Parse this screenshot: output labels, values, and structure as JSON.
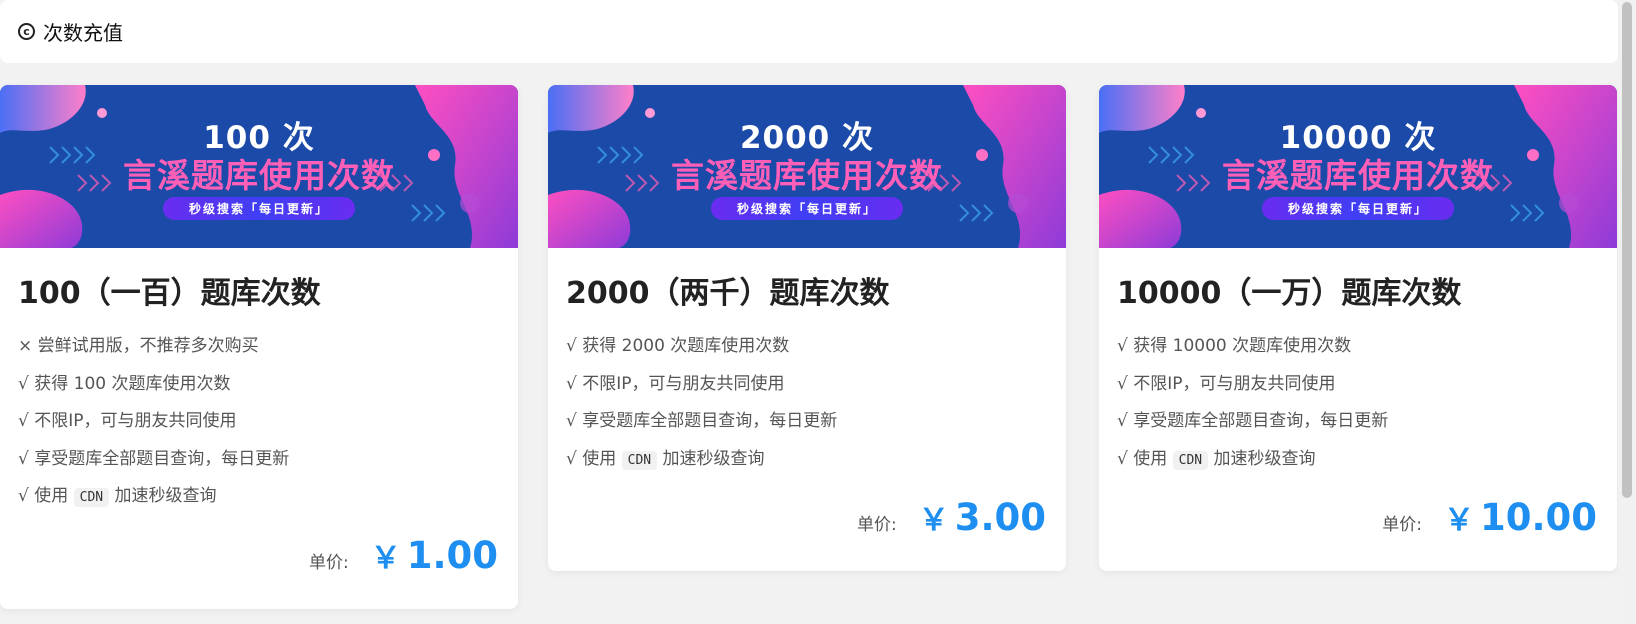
{
  "header": {
    "title": "次数充值",
    "icon": "copyright-icon"
  },
  "cards": [
    {
      "banner": {
        "count": "100 次",
        "headline": "言溪题库使用次数",
        "pill": "秒级搜索「每日更新」"
      },
      "title": "100（一百）题库次数",
      "features": [
        "× 尝鲜试用版，不推荐多次购买",
        "√ 获得 100 次题库使用次数",
        "√ 不限IP，可与朋友共同使用",
        "√ 享受题库全部题目查询，每日更新"
      ],
      "cdn": {
        "prefix": "√ 使用",
        "code": "CDN",
        "suffix": "加速秒级查询"
      },
      "price_label": "单价:",
      "currency": "￥",
      "price": "1.00"
    },
    {
      "banner": {
        "count": "2000 次",
        "headline": "言溪题库使用次数",
        "pill": "秒级搜索「每日更新」"
      },
      "title": "2000（两千）题库次数",
      "features": [
        "√ 获得 2000 次题库使用次数",
        "√ 不限IP，可与朋友共同使用",
        "√ 享受题库全部题目查询，每日更新"
      ],
      "cdn": {
        "prefix": "√ 使用",
        "code": "CDN",
        "suffix": "加速秒级查询"
      },
      "price_label": "单价:",
      "currency": "￥",
      "price": "3.00"
    },
    {
      "banner": {
        "count": "10000 次",
        "headline": "言溪题库使用次数",
        "pill": "秒级搜索「每日更新」"
      },
      "title": "10000（一万）题库次数",
      "features": [
        "√ 获得 10000 次题库使用次数",
        "√ 不限IP，可与朋友共同使用",
        "√ 享受题库全部题目查询，每日更新"
      ],
      "cdn": {
        "prefix": "√ 使用",
        "code": "CDN",
        "suffix": "加速秒级查询"
      },
      "price_label": "单价:",
      "currency": "￥",
      "price": "10.00"
    }
  ],
  "colors": {
    "banner_bg": "#1c4aa9",
    "headline": "#ff5fb7",
    "price": "#1e8ff0"
  }
}
